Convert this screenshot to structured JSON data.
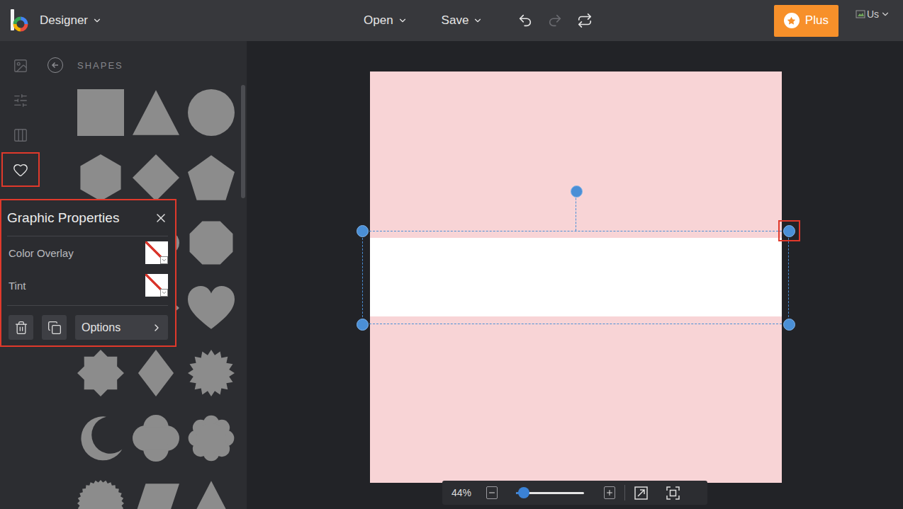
{
  "topbar": {
    "app_menu": "Designer",
    "menus": [
      "Open",
      "Save"
    ],
    "history": [
      {
        "kind": "undo",
        "disabled": false
      },
      {
        "kind": "redo",
        "disabled": true
      },
      {
        "kind": "repeat",
        "disabled": false
      }
    ],
    "plus_button": "Plus",
    "user": "Us"
  },
  "rail": {
    "items": [
      {
        "kind": "image",
        "selected": false,
        "highlighted": false
      },
      {
        "kind": "adjust",
        "selected": false,
        "highlighted": false
      },
      {
        "kind": "frames",
        "selected": false,
        "highlighted": false
      },
      {
        "kind": "graphics",
        "selected": true,
        "highlighted": true
      }
    ]
  },
  "shapes_panel": {
    "title": "SHAPES",
    "shapes": [
      {
        "kind": "square"
      },
      {
        "kind": "triangle"
      },
      {
        "kind": "circle"
      },
      {
        "kind": "hexagon"
      },
      {
        "kind": "diamond"
      },
      {
        "kind": "pentagon"
      },
      {
        "kind": "rounded-square"
      },
      {
        "kind": "ellipse"
      },
      {
        "kind": "octagon"
      },
      {
        "kind": "cross"
      },
      {
        "kind": "arrow"
      },
      {
        "kind": "heart"
      },
      {
        "kind": "star"
      },
      {
        "kind": "rhombus"
      },
      {
        "kind": "burst"
      },
      {
        "kind": "moon"
      },
      {
        "kind": "quatrefoil"
      },
      {
        "kind": "flower"
      },
      {
        "kind": "seal"
      },
      {
        "kind": "parallelogram"
      },
      {
        "kind": "triangle"
      }
    ]
  },
  "graphic_properties": {
    "title": "Graphic Properties",
    "highlighted": true,
    "rows": [
      {
        "label": "Color Overlay",
        "empty": true
      },
      {
        "label": "Tint",
        "empty": true
      }
    ],
    "options_button": "Options"
  },
  "canvas": {
    "selected_shape": {
      "kind": "rectangle",
      "selected": true
    },
    "handles": [
      {
        "position": "top-left",
        "highlighted": false
      },
      {
        "position": "top-right",
        "highlighted": true
      },
      {
        "position": "bottom-left",
        "highlighted": false
      },
      {
        "position": "bottom-right",
        "highlighted": false
      }
    ]
  },
  "zoom": {
    "reading": "44%",
    "level": 0.12
  }
}
